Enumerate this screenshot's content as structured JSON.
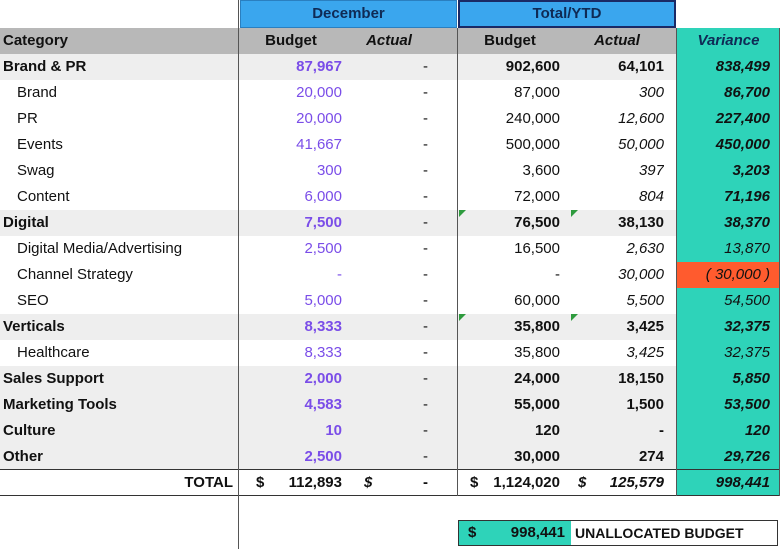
{
  "header": {
    "december": "December",
    "total_ytd": "Total/YTD"
  },
  "columns": {
    "category": "Category",
    "dec_budget": "Budget",
    "dec_actual": "Actual",
    "ytd_budget": "Budget",
    "ytd_actual": "Actual",
    "variance": "Variance"
  },
  "rows": [
    {
      "category": "Brand & PR",
      "dec_budget": "87,967",
      "dec_actual": "-",
      "ytd_budget": "902,600",
      "ytd_actual": "64,101",
      "variance": "838,499"
    },
    {
      "category": "Brand",
      "dec_budget": "20,000",
      "dec_actual": "-",
      "ytd_budget": "87,000",
      "ytd_actual": "300",
      "variance": "86,700"
    },
    {
      "category": "PR",
      "dec_budget": "20,000",
      "dec_actual": "-",
      "ytd_budget": "240,000",
      "ytd_actual": "12,600",
      "variance": "227,400"
    },
    {
      "category": "Events",
      "dec_budget": "41,667",
      "dec_actual": "-",
      "ytd_budget": "500,000",
      "ytd_actual": "50,000",
      "variance": "450,000"
    },
    {
      "category": "Swag",
      "dec_budget": "300",
      "dec_actual": "-",
      "ytd_budget": "3,600",
      "ytd_actual": "397",
      "variance": "3,203"
    },
    {
      "category": "Content",
      "dec_budget": "6,000",
      "dec_actual": "-",
      "ytd_budget": "72,000",
      "ytd_actual": "804",
      "variance": "71,196"
    },
    {
      "category": "Digital",
      "dec_budget": "7,500",
      "dec_actual": "-",
      "ytd_budget": "76,500",
      "ytd_actual": "38,130",
      "variance": "38,370"
    },
    {
      "category": "Digital Media/Advertising",
      "dec_budget": "2,500",
      "dec_actual": "-",
      "ytd_budget": "16,500",
      "ytd_actual": "2,630",
      "variance": "13,870"
    },
    {
      "category": "Channel Strategy",
      "dec_budget": "-",
      "dec_actual": "-",
      "ytd_budget": "-",
      "ytd_actual": "30,000",
      "variance": "( 30,000 )"
    },
    {
      "category": "SEO",
      "dec_budget": "5,000",
      "dec_actual": "-",
      "ytd_budget": "60,000",
      "ytd_actual": "5,500",
      "variance": "54,500"
    },
    {
      "category": "Verticals",
      "dec_budget": "8,333",
      "dec_actual": "-",
      "ytd_budget": "35,800",
      "ytd_actual": "3,425",
      "variance": "32,375"
    },
    {
      "category": "Healthcare",
      "dec_budget": "8,333",
      "dec_actual": "-",
      "ytd_budget": "35,800",
      "ytd_actual": "3,425",
      "variance": "32,375"
    },
    {
      "category": "Sales Support",
      "dec_budget": "2,000",
      "dec_actual": "-",
      "ytd_budget": "24,000",
      "ytd_actual": "18,150",
      "variance": "5,850"
    },
    {
      "category": "Marketing Tools",
      "dec_budget": "4,583",
      "dec_actual": "-",
      "ytd_budget": "55,000",
      "ytd_actual": "1,500",
      "variance": "53,500"
    },
    {
      "category": "Culture",
      "dec_budget": "10",
      "dec_actual": "-",
      "ytd_budget": "120",
      "ytd_actual": "-",
      "variance": "120"
    },
    {
      "category": "Other",
      "dec_budget": "2,500",
      "dec_actual": "-",
      "ytd_budget": "30,000",
      "ytd_actual": "274",
      "variance": "29,726"
    }
  ],
  "total": {
    "label": "TOTAL",
    "currency": "$",
    "dec_budget": "112,893",
    "dec_actual": "-",
    "ytd_budget": "1,124,020",
    "ytd_actual": "125,579",
    "variance": "998,441"
  },
  "unallocated": {
    "currency": "$",
    "amount": "998,441",
    "label": "UNALLOCATED BUDGET"
  },
  "colors": {
    "header_blue": "#3aa6ee",
    "variance_teal": "#2ed3b9",
    "negative_red": "#ff5b2e",
    "budget_purple": "#7a4de8"
  }
}
